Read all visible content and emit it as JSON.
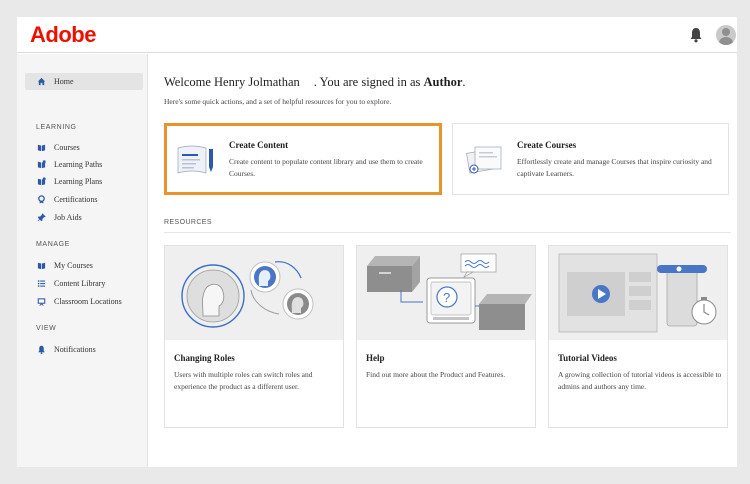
{
  "header": {
    "logo": "Adobe",
    "bell_icon": "bell-icon",
    "avatar_icon": "user-avatar-icon"
  },
  "sidebar": {
    "home": {
      "label": "Home",
      "icon": "home-icon"
    },
    "learning_head": "LEARNING",
    "learning": [
      {
        "label": "Courses",
        "icon": "book-icon"
      },
      {
        "label": "Learning Paths",
        "icon": "learning-path-icon"
      },
      {
        "label": "Learning Plans",
        "icon": "learning-plan-icon"
      },
      {
        "label": "Certifications",
        "icon": "certificate-icon"
      },
      {
        "label": "Job Aids",
        "icon": "pin-icon"
      }
    ],
    "manage_head": "MANAGE",
    "manage": [
      {
        "label": "My Courses",
        "icon": "book-icon"
      },
      {
        "label": "Content Library",
        "icon": "list-icon"
      },
      {
        "label": "Classroom Locations",
        "icon": "classroom-icon"
      }
    ],
    "view_head": "VIEW",
    "view": [
      {
        "label": "Notifications",
        "icon": "bell-icon"
      }
    ]
  },
  "main": {
    "welcome_prefix": "Welcome",
    "user_name": "Henry Jolmathan",
    "welcome_middle": ". You are signed in as",
    "role": "Author",
    "welcome_suffix": ".",
    "subtitle": "Here's some quick actions, and a set of helpful resources for you to explore.",
    "quick_actions": [
      {
        "title": "Create Content",
        "desc": "Create content to populate content library and use them to create Courses."
      },
      {
        "title": "Create Courses",
        "desc": "Effortlessly create and manage Courses that inspire curiosity and captivate Learners."
      }
    ],
    "resources_head": "RESOURCES",
    "resources": [
      {
        "title": "Changing Roles",
        "desc": "Users with multiple roles can switch roles and experience the product as a different user."
      },
      {
        "title": "Help",
        "desc": "Find out more about the Product and Features."
      },
      {
        "title": "Tutorial Videos",
        "desc": "A growing collection of tutorial videos is accessible to admins and authors any time."
      }
    ]
  },
  "colors": {
    "brand": "#eb1000",
    "highlight": "#e8932b",
    "icon_blue": "#2d5aa8"
  }
}
